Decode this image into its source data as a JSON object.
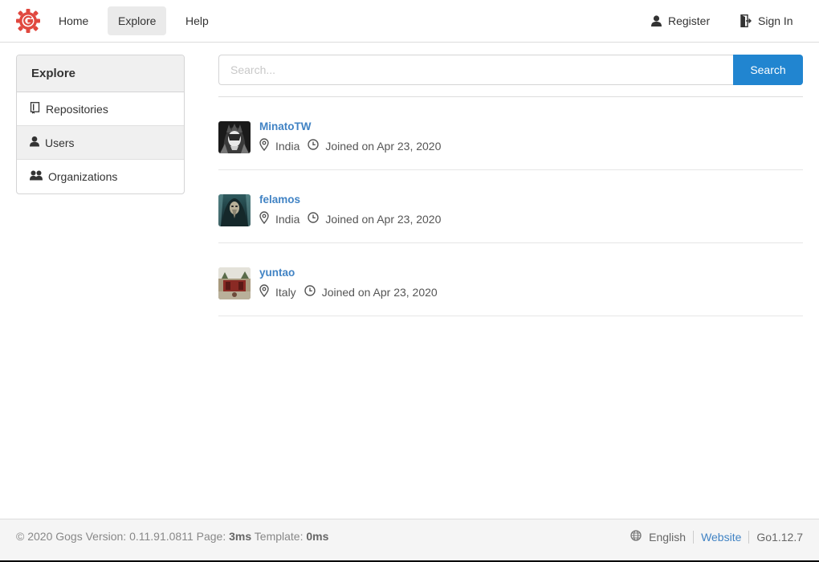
{
  "header": {
    "logo_icon": "gogs-logo-icon",
    "nav": [
      {
        "label": "Home"
      },
      {
        "label": "Explore"
      },
      {
        "label": "Help"
      }
    ],
    "register_label": "Register",
    "signin_label": "Sign In"
  },
  "sidebar": {
    "title": "Explore",
    "items": [
      {
        "label": "Repositories",
        "icon": "repo-icon"
      },
      {
        "label": "Users",
        "icon": "user-icon"
      },
      {
        "label": "Organizations",
        "icon": "organization-icon"
      }
    ]
  },
  "search": {
    "placeholder": "Search...",
    "button_label": "Search"
  },
  "users": [
    {
      "name": "MinatoTW",
      "location": "India",
      "joined": "Joined on Apr 23, 2020"
    },
    {
      "name": "felamos",
      "location": "India",
      "joined": "Joined on Apr 23, 2020"
    },
    {
      "name": "yuntao",
      "location": "Italy",
      "joined": "Joined on Apr 23, 2020"
    }
  ],
  "footer": {
    "copyright": "© 2020 Gogs Version: 0.11.91.0811 Page: ",
    "page_time": "3ms",
    "template_label": " Template: ",
    "template_time": "0ms",
    "language": "English",
    "website_label": "Website",
    "go_version": "Go1.12.7"
  },
  "colors": {
    "primary": "#2185d0",
    "link": "#4183c4",
    "logo": "#e0483f"
  }
}
